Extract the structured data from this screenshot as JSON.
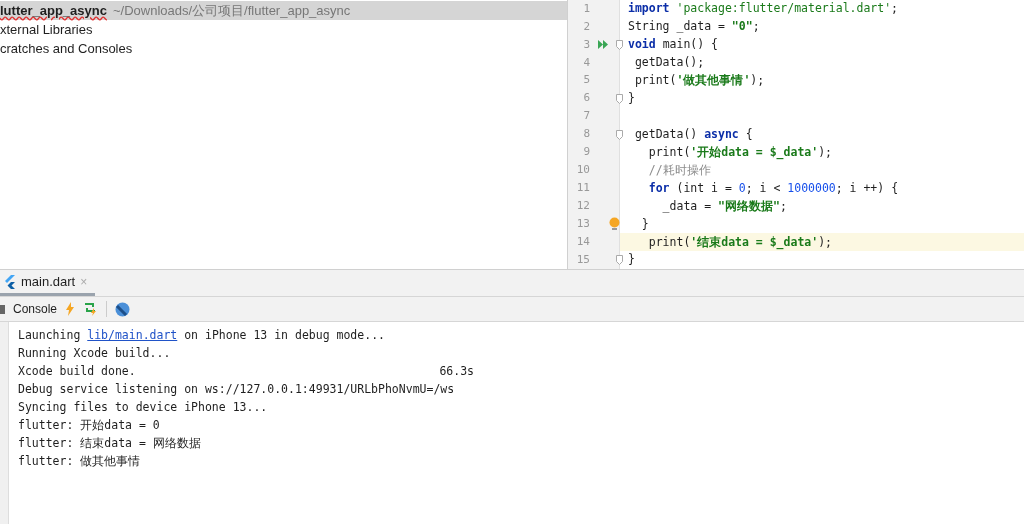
{
  "project_tree": [
    {
      "name": "lutter_app_async",
      "path": "~/Downloads/公司项目/flutter_app_async",
      "selected": true
    },
    {
      "name": "xternal Libraries",
      "selected": false
    },
    {
      "name": "cratches and Consoles",
      "selected": false
    }
  ],
  "editor": {
    "lines": [
      {
        "number": "1",
        "current": false,
        "fold": false,
        "tokens": [
          {
            "t": "import",
            "kind": "keyword"
          },
          {
            "t": " 'package:flutter/material.dart'",
            "kind": "string"
          },
          {
            "t": ";",
            "kind": "plain"
          }
        ]
      },
      {
        "number": "2",
        "current": false,
        "fold": false,
        "tokens": [
          {
            "t": "String _data = ",
            "kind": "plain"
          },
          {
            "t": "\"0\"",
            "kind": "boldstring"
          },
          {
            "t": ";",
            "kind": "plain"
          }
        ]
      },
      {
        "number": "3",
        "current": false,
        "gutter_marker": {
          "kind": "run"
        },
        "fold": true,
        "tokens": [
          {
            "t": "void",
            "kind": "keyword"
          },
          {
            "t": " main() {",
            "kind": "plain"
          }
        ]
      },
      {
        "number": "4",
        "current": false,
        "fold": false,
        "tokens": [
          {
            "t": " getData();",
            "kind": "plain"
          }
        ]
      },
      {
        "number": "5",
        "current": false,
        "fold": false,
        "tokens": [
          {
            "t": " print(",
            "kind": "plain"
          },
          {
            "t": "'做其他事情'",
            "kind": "boldstring"
          },
          {
            "t": ");",
            "kind": "plain"
          }
        ]
      },
      {
        "number": "6",
        "current": false,
        "fold": true,
        "tokens": [
          {
            "t": "}",
            "kind": "plain"
          }
        ]
      },
      {
        "number": "7",
        "current": false,
        "fold": false
      },
      {
        "number": "8",
        "current": false,
        "fold": true,
        "tokens": [
          {
            "t": " getData() ",
            "kind": "plain"
          },
          {
            "t": "async",
            "kind": "keyword"
          },
          {
            "t": " {",
            "kind": "plain"
          }
        ]
      },
      {
        "number": "9",
        "current": false,
        "fold": false,
        "tokens": [
          {
            "t": "   print(",
            "kind": "plain"
          },
          {
            "t": "'开始data = $_data'",
            "kind": "boldstring"
          },
          {
            "t": ");",
            "kind": "plain"
          }
        ]
      },
      {
        "number": "10",
        "current": false,
        "fold": false,
        "tokens": [
          {
            "t": "   //耗时操作",
            "kind": "comment"
          }
        ]
      },
      {
        "number": "11",
        "current": false,
        "fold": false,
        "tokens": [
          {
            "t": "   for",
            "kind": "keyword"
          },
          {
            "t": " (int i = ",
            "kind": "plain"
          },
          {
            "t": "0",
            "kind": "number"
          },
          {
            "t": "; i < ",
            "kind": "plain"
          },
          {
            "t": "1000000",
            "kind": "number"
          },
          {
            "t": "; i ++) {",
            "kind": "plain"
          }
        ]
      },
      {
        "number": "12",
        "current": false,
        "fold": false,
        "tokens": [
          {
            "t": "     _data = ",
            "kind": "plain"
          },
          {
            "t": "\"网络数据\"",
            "kind": "boldstring"
          },
          {
            "t": ";",
            "kind": "plain"
          }
        ]
      },
      {
        "number": "13",
        "current": false,
        "gutter_marker": {
          "kind": "bulb"
        },
        "fold": false,
        "tokens": [
          {
            "t": "  }",
            "kind": "plain"
          }
        ]
      },
      {
        "number": "14",
        "current": true,
        "fold": false,
        "tokens": [
          {
            "t": "   print(",
            "kind": "plain"
          },
          {
            "t": "'结束data = $_data'",
            "kind": "boldstring"
          },
          {
            "t": ");",
            "kind": "plain"
          }
        ]
      },
      {
        "number": "15",
        "current": false,
        "fold": true,
        "tokens": [
          {
            "t": "}",
            "kind": "plain"
          }
        ]
      }
    ]
  },
  "run_tab": {
    "label": "main.dart",
    "close": "×"
  },
  "toolbar": {
    "console_label": "Console"
  },
  "console": [
    {
      "parts": [
        {
          "t": "Launching ",
          "kind": "plain"
        },
        {
          "t": "lib/main.dart",
          "kind": "link"
        },
        {
          "t": " on iPhone 13 in debug mode...",
          "kind": "plain"
        }
      ]
    },
    {
      "parts": [
        {
          "t": "Running Xcode build...",
          "kind": "plain"
        }
      ]
    },
    {
      "parts": [
        {
          "t": "Xcode build done.",
          "kind": "plain"
        }
      ],
      "time": "66.3s"
    },
    {
      "parts": [
        {
          "t": "Debug service listening on ws://127.0.0.1:49931/URLbPhoNvmU=/ws",
          "kind": "plain"
        }
      ]
    },
    {
      "parts": [
        {
          "t": "Syncing files to device iPhone 13...",
          "kind": "plain"
        }
      ]
    },
    {
      "parts": [
        {
          "t": "flutter: 开始data = 0",
          "kind": "plain"
        }
      ]
    },
    {
      "parts": [
        {
          "t": "flutter: 结束data = 网络数据",
          "kind": "plain"
        }
      ]
    },
    {
      "parts": [
        {
          "t": "flutter: 做其他事情",
          "kind": "plain"
        }
      ]
    }
  ]
}
